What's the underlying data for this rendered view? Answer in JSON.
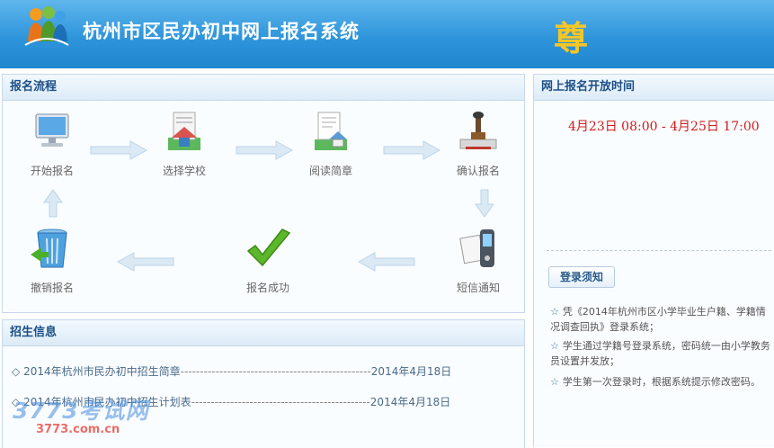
{
  "header": {
    "title": "杭州市区民办初中网上报名系统",
    "zun": "尊"
  },
  "flow": {
    "heading": "报名流程",
    "steps": [
      {
        "label": "开始报名",
        "icon": "monitor-icon"
      },
      {
        "label": "选择学校",
        "icon": "school-building-icon"
      },
      {
        "label": "阅读简章",
        "icon": "document-house-icon"
      },
      {
        "label": "确认报名",
        "icon": "stamp-icon"
      },
      {
        "label": "短信通知",
        "icon": "mobile-phone-icon"
      },
      {
        "label": "报名成功",
        "icon": "checkmark-icon"
      },
      {
        "label": "撤销报名",
        "icon": "recycle-bin-icon"
      }
    ]
  },
  "info": {
    "heading": "招生信息",
    "items": [
      {
        "title": "2014年杭州市民办初中招生简章",
        "dash": "-------------------------------------------------",
        "date": "2014年4月18日"
      },
      {
        "title": "2014年杭州市民办初中招生计划表",
        "dash": "----------------------------------------------",
        "date": "2014年4月18日"
      }
    ]
  },
  "side": {
    "heading": "网上报名开放时间",
    "open_time": "4月23日 08:00 - 4月25日 17:00",
    "notice_label": "登录须知",
    "rules": [
      "凭《2014年杭州市区小学毕业生户籍、学籍情况调查回执》登录系统；",
      "学生通过学籍号登录系统，密码统一由小学教务员设置并发放；",
      "学生第一次登录时，根据系统提示修改密码。"
    ]
  },
  "watermark": {
    "main": "3773考试网",
    "sub": "3773.com.cn"
  },
  "colors": {
    "header": "#2f95db",
    "open_time": "#d11b1b",
    "zun": "#f7c625"
  }
}
